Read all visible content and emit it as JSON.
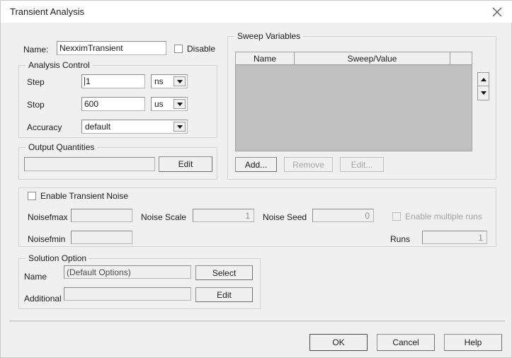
{
  "window": {
    "title": "Transient Analysis",
    "close_icon": "close-icon"
  },
  "name_row": {
    "label": "Name:",
    "value": "NexximTransient",
    "disable_label": "Disable",
    "disable_checked": false
  },
  "analysis_control": {
    "title": "Analysis Control",
    "step": {
      "label": "Step",
      "value": "1",
      "unit": "ns"
    },
    "stop": {
      "label": "Stop",
      "value": "600",
      "unit": "us"
    },
    "accuracy": {
      "label": "Accuracy",
      "value": "default"
    }
  },
  "output_quantities": {
    "title": "Output Quantities",
    "value": "",
    "edit_label": "Edit"
  },
  "transient_noise": {
    "enable_label": "Enable Transient Noise",
    "enable_checked": false,
    "noisefmax": {
      "label": "Noisefmax",
      "value": ""
    },
    "noisefmin": {
      "label": "Noisefmin",
      "value": ""
    },
    "noise_scale": {
      "label": "Noise Scale",
      "value": "1"
    },
    "noise_seed": {
      "label": "Noise Seed",
      "value": "0"
    },
    "enable_multiple_runs": {
      "label": "Enable multiple runs",
      "checked": false
    },
    "runs": {
      "label": "Runs",
      "value": "1"
    }
  },
  "solution_option": {
    "title": "Solution Option",
    "name": {
      "label": "Name",
      "value": "(Default Options)",
      "button": "Select"
    },
    "additional": {
      "label": "Additional",
      "value": "",
      "button": "Edit"
    }
  },
  "sweep_variables": {
    "title": "Sweep Variables",
    "columns": [
      "Name",
      "Sweep/Value",
      ""
    ],
    "rows": [],
    "add_label": "Add...",
    "remove_label": "Remove",
    "edit_label": "Edit...",
    "spinner_up": "arrow-up-icon",
    "spinner_down": "arrow-down-icon"
  },
  "footer": {
    "ok": "OK",
    "cancel": "Cancel",
    "help": "Help"
  }
}
